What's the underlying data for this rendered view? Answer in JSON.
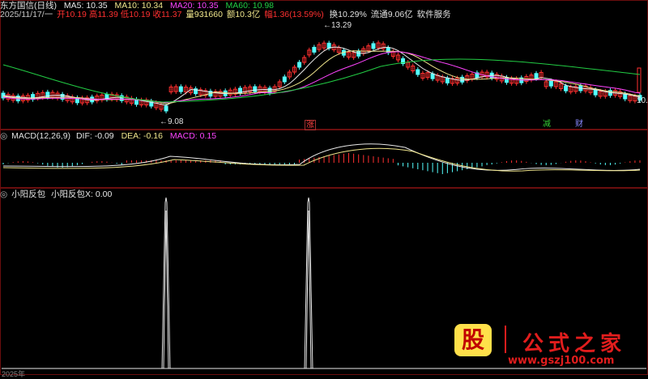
{
  "window": {
    "title": "东方国信(日线)",
    "date_label": "2025/11/17/一"
  },
  "ma_legend": [
    {
      "label": "MA5: 10.35",
      "color": "#e8e8e8"
    },
    {
      "label": "MA10: 10.34",
      "color": "#f0e68c"
    },
    {
      "label": "MA20: 10.35",
      "color": "#ff44ff"
    },
    {
      "label": "MA60: 10.98",
      "color": "#22cc44"
    }
  ],
  "quote": {
    "open": "开10.19",
    "high": "高11.39",
    "low": "低10.19",
    "close": "收11.37",
    "volume": "量931660",
    "amount": "额10.3亿",
    "change": "幅1.36(13.59%)",
    "turnover": "换10.29%",
    "float_cap": "流通9.06亿",
    "sector": "软件服务"
  },
  "price_markers": {
    "high_label": "13.29",
    "low_label": "9.08",
    "right_price": "10."
  },
  "event_tags": [
    {
      "label": "涨",
      "color": "#ff4040"
    },
    {
      "label": "减",
      "color": "#33cc33"
    },
    {
      "label": "财",
      "color": "#8888ff"
    }
  ],
  "macd_panel": {
    "title": "MACD(12,26,9)",
    "dif": "DIF: -0.09",
    "dea": "DEA: -0.16",
    "macd": "MACD: 0.15"
  },
  "indicator_panel": {
    "title": "小阳反包",
    "value": "小阳反包X: 0.00"
  },
  "axis": {
    "bottom_left": "2025年"
  },
  "logo": {
    "gu": "股",
    "title": "公式之家",
    "url": "www.gszj100.com"
  },
  "colors": {
    "up": "#ff3030",
    "down": "#54ffff",
    "panel_border": "#6a0e0e",
    "ma5": "#e8e8e8",
    "ma10": "#f0e68c",
    "ma20": "#ff44ff",
    "ma60": "#22cc44"
  }
}
